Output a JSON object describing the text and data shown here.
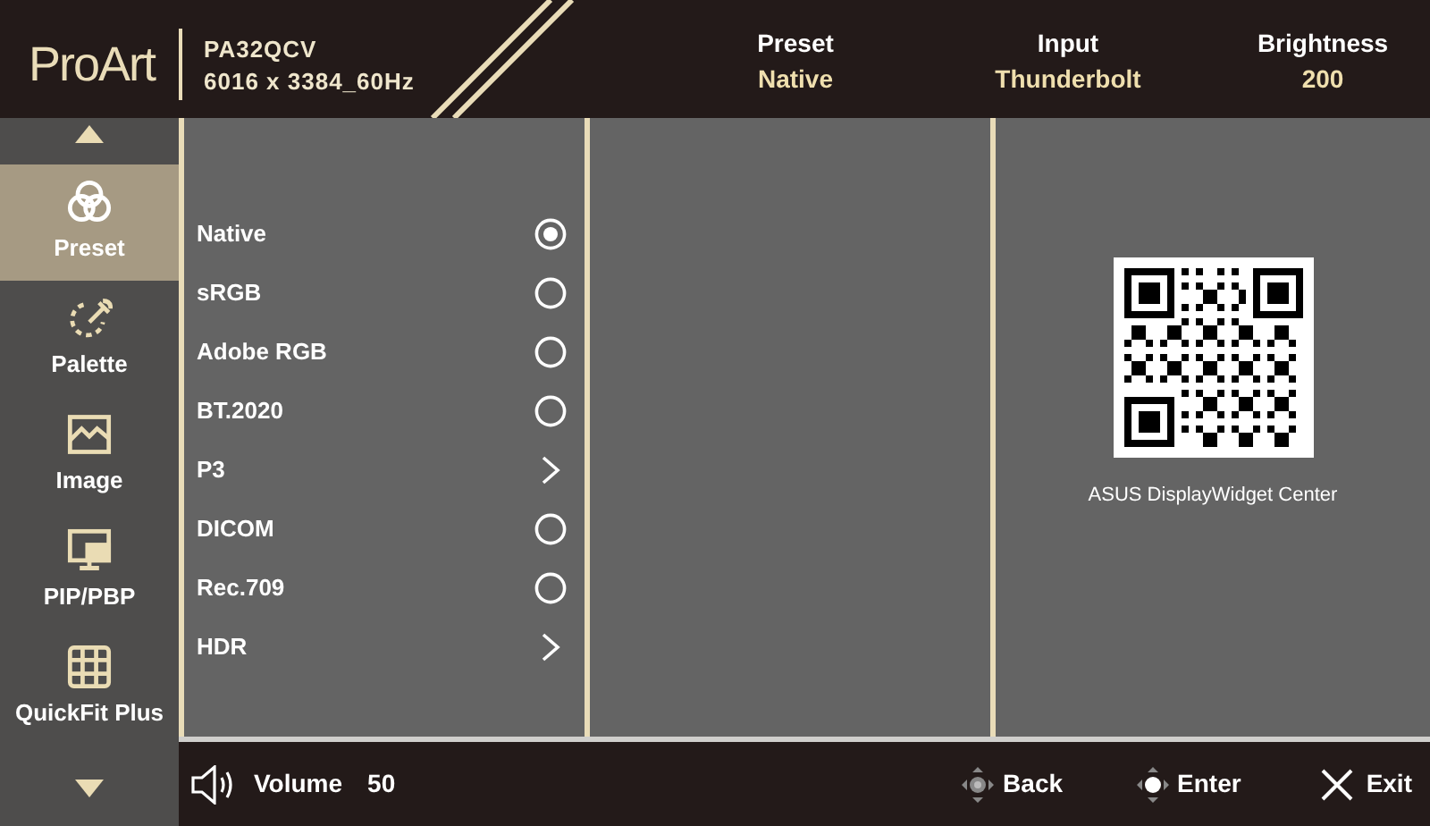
{
  "header": {
    "logo": "ProArt",
    "model": "PA32QCV",
    "resolution": "6016 x 3384_60Hz",
    "status": [
      {
        "label": "Preset",
        "value": "Native"
      },
      {
        "label": "Input",
        "value": "Thunderbolt"
      },
      {
        "label": "Brightness",
        "value": "200"
      }
    ]
  },
  "sidebar": {
    "items": [
      {
        "label": "Preset",
        "selected": true
      },
      {
        "label": "Palette",
        "selected": false
      },
      {
        "label": "Image",
        "selected": false
      },
      {
        "label": "PIP/PBP",
        "selected": false
      },
      {
        "label": "QuickFit Plus",
        "selected": false
      }
    ]
  },
  "menu": {
    "items": [
      {
        "label": "Native",
        "kind": "radio",
        "selected": true
      },
      {
        "label": "sRGB",
        "kind": "radio",
        "selected": false
      },
      {
        "label": "Adobe RGB",
        "kind": "radio",
        "selected": false
      },
      {
        "label": "BT.2020",
        "kind": "radio",
        "selected": false
      },
      {
        "label": "P3",
        "kind": "submenu",
        "selected": false
      },
      {
        "label": "DICOM",
        "kind": "radio",
        "selected": false
      },
      {
        "label": "Rec.709",
        "kind": "radio",
        "selected": false
      },
      {
        "label": "HDR",
        "kind": "submenu",
        "selected": false
      }
    ]
  },
  "qr_panel": {
    "caption": "ASUS DisplayWidget Center"
  },
  "footer": {
    "volume": {
      "label": "Volume",
      "value": "50"
    },
    "actions": [
      {
        "label": "Back"
      },
      {
        "label": "Enter"
      },
      {
        "label": "Exit"
      }
    ]
  }
}
